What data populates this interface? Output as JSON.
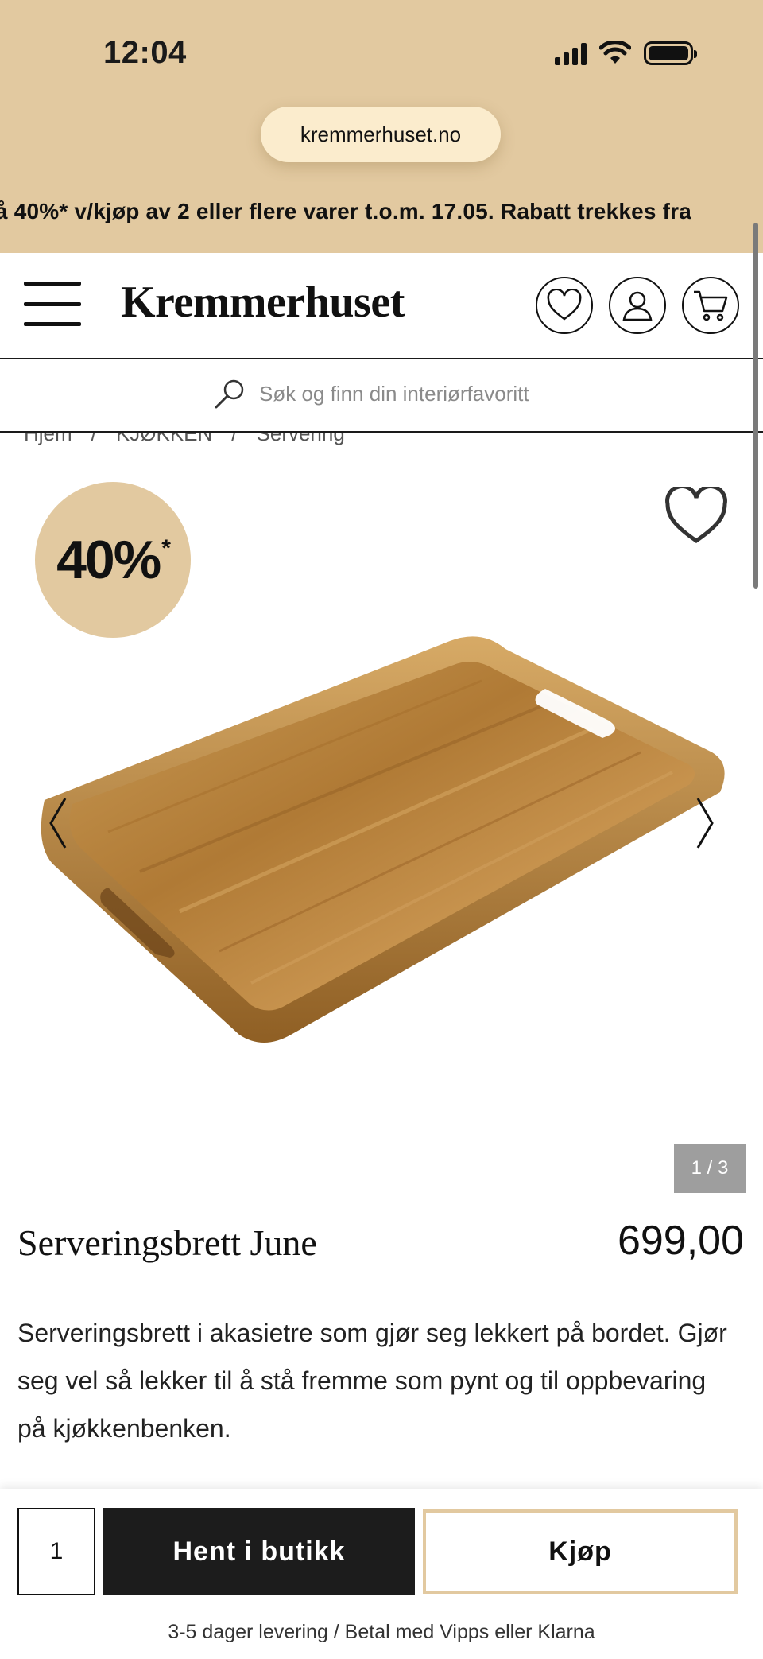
{
  "status_bar": {
    "time": "12:04"
  },
  "browser": {
    "url": "kremmerhuset.no"
  },
  "promo": {
    "text": "å 40%* v/kjøp av 2 eller flere varer t.o.m. 17.05. Rabatt trekkes fra"
  },
  "header": {
    "logo": "Kremmerhuset"
  },
  "search": {
    "placeholder": "Søk og finn din interiørfavoritt"
  },
  "breadcrumb": {
    "items": [
      "Hjem",
      "KJØKKEN",
      "Servering"
    ]
  },
  "product": {
    "discount_label": "40%",
    "discount_mark": "*",
    "image_counter": "1 / 3",
    "title": "Serveringsbrett June",
    "price": "699,00",
    "description": "Serveringsbrett i akasietre som gjør seg lekkert på bordet. Gjør seg vel så lekker til å stå fremme som pynt og til oppbevaring på kjøkkenbenken."
  },
  "buy_bar": {
    "quantity": "1",
    "pickup_label": "Hent i butikk",
    "buy_label": "Kjøp",
    "delivery_note": "3-5 dager levering / Betal med Vipps eller Klarna"
  },
  "colors": {
    "accent": "#e2c9a0",
    "dark": "#1c1c1c"
  }
}
